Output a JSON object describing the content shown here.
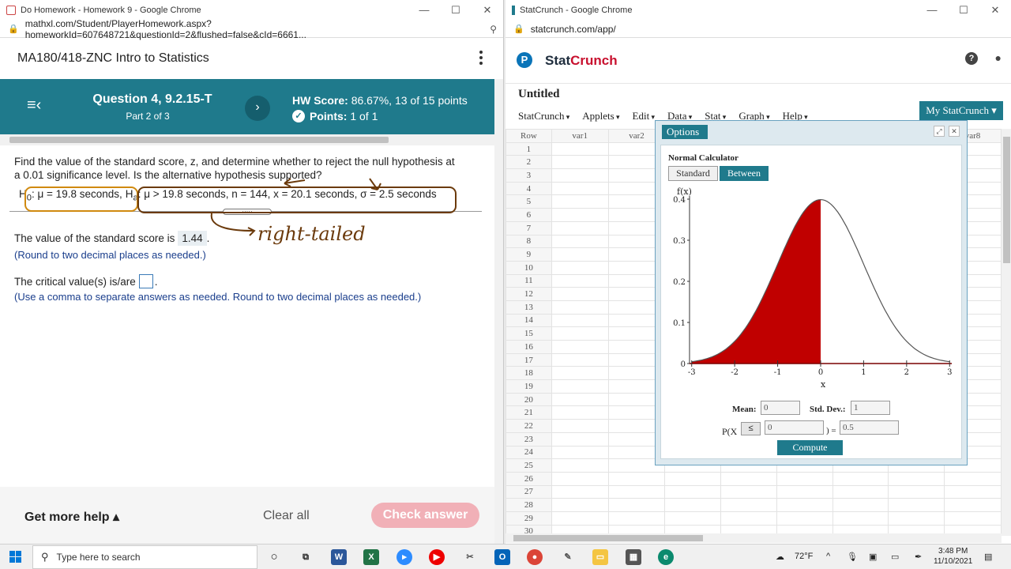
{
  "left_window": {
    "title": "Do Homework - Homework 9 - Google Chrome",
    "url": "mathxl.com/Student/PlayerHomework.aspx?homeworkId=607648721&questionId=2&flushed=false&cId=6661...",
    "course_title": "MA180/418-ZNC Intro to Statistics",
    "question_title": "Question 4, 9.2.15-T",
    "question_part": "Part 2 of 3",
    "hw_score_label": "HW Score:",
    "hw_score_value": "86.67%, 13 of 15 points",
    "points_label": "Points:",
    "points_value": "1 of 1",
    "question_text": "Find the value of the standard score, z, and determine whether to reject the null hypothesis at a 0.01 significance level. Is the alternative hypothesis supported?",
    "h0_text": "H",
    "h0_sub": "0",
    "h0_rest": ": μ = 19.8 seconds,",
    "ha_text": "H",
    "ha_sub": "a",
    "ha_rest": ": μ > 19.8 seconds, n = 144, x = 20.1 seconds, σ = 2.5 seconds",
    "ans1_prefix": "The value of the standard score is",
    "ans1_value": "1.44",
    "ans1_suffix": ".",
    "note1": "(Round to two decimal places as needed.)",
    "ans2_prefix": "The critical value(s) is/are",
    "ans2_suffix": ".",
    "note2": "(Use a comma to separate answers as needed. Round to two decimal places as needed.)",
    "handwriting": "right-tailed",
    "get_more_help": "Get more help ▴",
    "clear_all": "Clear all",
    "check_answer": "Check answer"
  },
  "right_window": {
    "title": "StatCrunch - Google Chrome",
    "url": "statcrunch.com/app/",
    "brand_a": "Stat",
    "brand_b": "Crunch",
    "sheet_title": "Untitled",
    "menus": [
      "StatCrunch",
      "Applets",
      "Edit",
      "Data",
      "Stat",
      "Graph",
      "Help"
    ],
    "my_statcrunch": "My StatCrunch ▾",
    "grid_headers": [
      "Row",
      "var1",
      "var2",
      "",
      "",
      "",
      "",
      "",
      "var8"
    ],
    "rows": [
      "1",
      "2",
      "3",
      "4",
      "5",
      "6",
      "7",
      "8",
      "9",
      "10",
      "11",
      "12",
      "13",
      "14",
      "15",
      "16",
      "17",
      "18",
      "19",
      "20",
      "21",
      "22",
      "23",
      "24",
      "25",
      "26",
      "27",
      "28",
      "29",
      "30"
    ],
    "dialog": {
      "options": "Options",
      "calc_title": "Normal Calculator",
      "tab_standard": "Standard",
      "tab_between": "Between",
      "y_label": "f(x)",
      "x_label": "x",
      "y_ticks": [
        "0.4",
        "0.3",
        "0.2",
        "0.1",
        "0"
      ],
      "x_ticks": [
        "-3",
        "-2",
        "-1",
        "0",
        "1",
        "2",
        "3"
      ],
      "mean_label": "Mean:",
      "mean_value": "0",
      "sd_label": "Std. Dev.:",
      "sd_value": "1",
      "p_label_open": "P(X",
      "p_op": "≤",
      "p_x_value": "0",
      "p_label_close": ") =",
      "p_result": "0.5",
      "compute": "Compute"
    }
  },
  "taskbar": {
    "search_placeholder": "Type here to search",
    "weather": "72°F",
    "time": "3:48 PM",
    "date": "11/10/2021"
  }
}
